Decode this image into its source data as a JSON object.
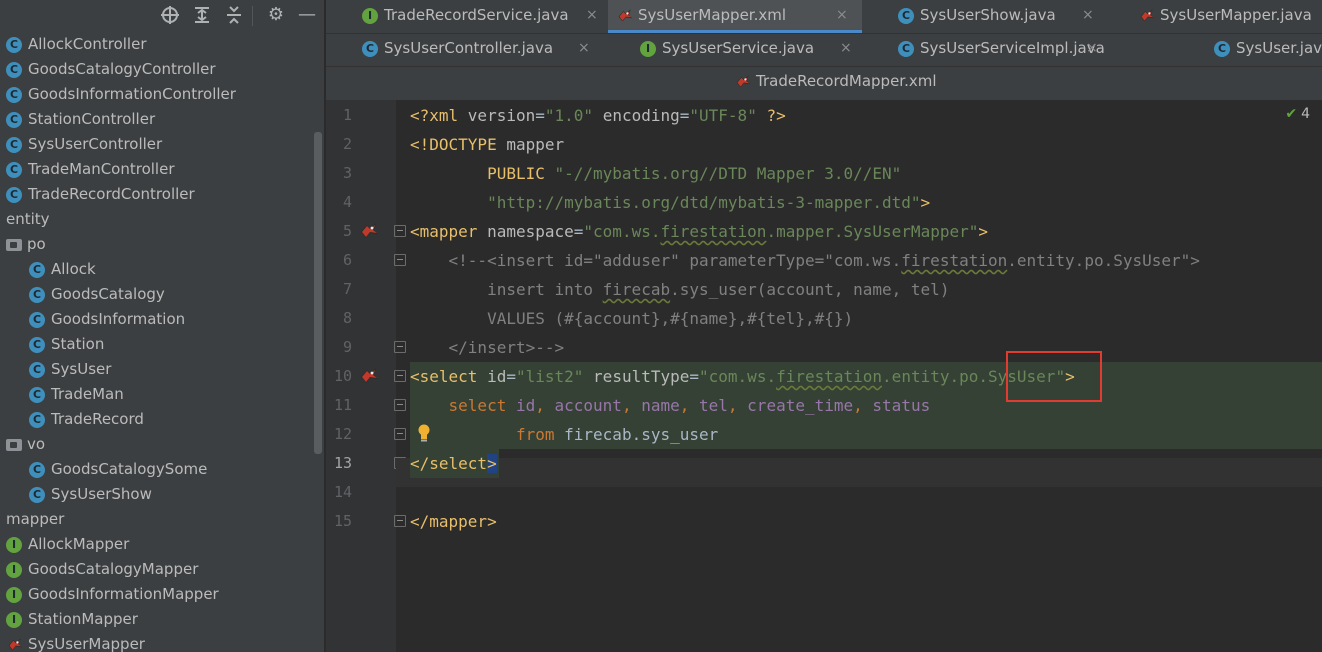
{
  "tree_toolbar": {
    "icons": [
      "locate-icon",
      "expand-all-icon",
      "collapse-all-icon",
      "gear-icon",
      "minimize-icon"
    ]
  },
  "tree": {
    "items": [
      {
        "label": "AllockController",
        "icon": "c"
      },
      {
        "label": "GoodsCatalogyController",
        "icon": "c"
      },
      {
        "label": "GoodsInformationController",
        "icon": "c"
      },
      {
        "label": "StationController",
        "icon": "c"
      },
      {
        "label": "SysUserController",
        "icon": "c"
      },
      {
        "label": "TradeManController",
        "icon": "c"
      },
      {
        "label": "TradeRecordController",
        "icon": "c"
      },
      {
        "label": "entity",
        "icon": "none"
      },
      {
        "label": "po",
        "icon": "folder"
      },
      {
        "label": "Allock",
        "icon": "c"
      },
      {
        "label": "GoodsCatalogy",
        "icon": "c"
      },
      {
        "label": "GoodsInformation",
        "icon": "c"
      },
      {
        "label": "Station",
        "icon": "c"
      },
      {
        "label": "SysUser",
        "icon": "c"
      },
      {
        "label": "TradeMan",
        "icon": "c"
      },
      {
        "label": "TradeRecord",
        "icon": "c"
      },
      {
        "label": "vo",
        "icon": "folder"
      },
      {
        "label": "GoodsCatalogySome",
        "icon": "c"
      },
      {
        "label": "SysUserShow",
        "icon": "c"
      },
      {
        "label": "mapper",
        "icon": "none"
      },
      {
        "label": "AllockMapper",
        "icon": "i"
      },
      {
        "label": "GoodsCatalogyMapper",
        "icon": "i"
      },
      {
        "label": "GoodsInformationMapper",
        "icon": "i"
      },
      {
        "label": "StationMapper",
        "icon": "i"
      },
      {
        "label": "SysUserMapper",
        "icon": "bird"
      }
    ]
  },
  "tabs": {
    "row1": [
      {
        "label": "TradeRecordService.java",
        "icon": "i",
        "close": "×"
      },
      {
        "label": "SysUserMapper.xml",
        "icon": "bird",
        "close": "×",
        "active": true
      },
      {
        "label": "SysUserShow.java",
        "icon": "c",
        "close": "×"
      },
      {
        "label": "SysUserMapper.java",
        "icon": "bird",
        "close": ""
      }
    ],
    "row2": [
      {
        "label": "SysUserController.java",
        "icon": "c",
        "close": "×"
      },
      {
        "label": "SysUserService.java",
        "icon": "i",
        "close": "×"
      },
      {
        "label": "SysUserServiceImpl.java",
        "icon": "c",
        "close": "×"
      },
      {
        "label": "SysUser.java",
        "icon": "c",
        "close": ""
      }
    ],
    "row3": [
      {
        "label": "TradeRecordMapper.xml",
        "icon": "bird",
        "close": ""
      }
    ]
  },
  "editor": {
    "inspection_count": "4",
    "line_numbers": [
      "1",
      "2",
      "3",
      "4",
      "5",
      "6",
      "7",
      "8",
      "9",
      "10",
      "11",
      "12",
      "13",
      "14",
      "15"
    ],
    "current_line": "13",
    "lines": [
      [
        [
          "t-tag",
          "<?xml "
        ],
        [
          "t-attr",
          "version"
        ],
        [
          "t-plain",
          "="
        ],
        [
          "t-val",
          "\"1.0\""
        ],
        [
          "t-plain",
          " "
        ],
        [
          "t-attr",
          "encoding"
        ],
        [
          "t-plain",
          "="
        ],
        [
          "t-val",
          "\"UTF-8\""
        ],
        [
          "t-plain",
          " "
        ],
        [
          "t-tag",
          "?>"
        ]
      ],
      [
        [
          "t-tag",
          "<!DOCTYPE "
        ],
        [
          "t-attr",
          "mapper"
        ]
      ],
      [
        [
          "t-plain",
          "        "
        ],
        [
          "t-doc",
          "PUBLIC "
        ],
        [
          "t-str",
          "\"-//mybatis.org//DTD Mapper 3.0//EN\""
        ]
      ],
      [
        [
          "t-plain",
          "        "
        ],
        [
          "t-str",
          "\"http://mybatis.org/dtd/mybatis-3-mapper.dtd\""
        ],
        [
          "t-tag",
          ">"
        ]
      ],
      [
        [
          "t-tag",
          "<mapper "
        ],
        [
          "t-attr",
          "namespace"
        ],
        [
          "t-plain",
          "="
        ],
        [
          "t-val",
          "\"com.ws."
        ],
        [
          "t-val wavy",
          "firestation"
        ],
        [
          "t-val",
          ".mapper.SysUserMapper\""
        ],
        [
          "t-tag",
          ">"
        ]
      ],
      [
        [
          "t-plain",
          "    "
        ],
        [
          "t-comment",
          "<!--<insert id=\"adduser\" parameterType=\"com.ws."
        ],
        [
          "t-comment wavy",
          "firestation"
        ],
        [
          "t-comment",
          ".entity.po.SysUser\">"
        ]
      ],
      [
        [
          "t-plain",
          "        "
        ],
        [
          "t-comment",
          "insert into "
        ],
        [
          "t-comment wavy",
          "firecab"
        ],
        [
          "t-comment",
          ".sys_user(account, name, tel)"
        ]
      ],
      [
        [
          "t-plain",
          "        "
        ],
        [
          "t-comment",
          "VALUES (#{account},#{name},#{tel},#{})"
        ]
      ],
      [
        [
          "t-plain",
          "    "
        ],
        [
          "t-comment",
          "</insert>-->"
        ]
      ],
      [
        [
          "t-tag",
          "<select "
        ],
        [
          "t-attr",
          "id"
        ],
        [
          "t-plain",
          "="
        ],
        [
          "t-val",
          "\"list2\""
        ],
        [
          "t-plain",
          " "
        ],
        [
          "t-attr",
          "resultType"
        ],
        [
          "t-plain",
          "="
        ],
        [
          "t-val",
          "\"com.ws."
        ],
        [
          "t-val wavy",
          "firestation"
        ],
        [
          "t-val",
          ".entity.po.SysUser\""
        ],
        [
          "t-tag",
          ">"
        ]
      ],
      [
        [
          "t-plain",
          "    "
        ],
        [
          "t-sql",
          "select "
        ],
        [
          "t-col",
          "id"
        ],
        [
          "t-sql",
          ", "
        ],
        [
          "t-col",
          "account"
        ],
        [
          "t-sql",
          ", "
        ],
        [
          "t-col",
          "name"
        ],
        [
          "t-sql",
          ", "
        ],
        [
          "t-col",
          "tel"
        ],
        [
          "t-sql",
          ", "
        ],
        [
          "t-col",
          "create_time"
        ],
        [
          "t-sql",
          ", "
        ],
        [
          "t-col",
          "status"
        ]
      ],
      [
        [
          "t-plain",
          "           "
        ],
        [
          "t-sql",
          "from "
        ],
        [
          "t-plain",
          "firecab.sys_user"
        ]
      ],
      [
        [
          "t-tag",
          "</select"
        ],
        [
          "t-tag sel-end",
          ">"
        ]
      ],
      [],
      [
        [
          "t-tag",
          "</mapper>"
        ]
      ]
    ]
  }
}
